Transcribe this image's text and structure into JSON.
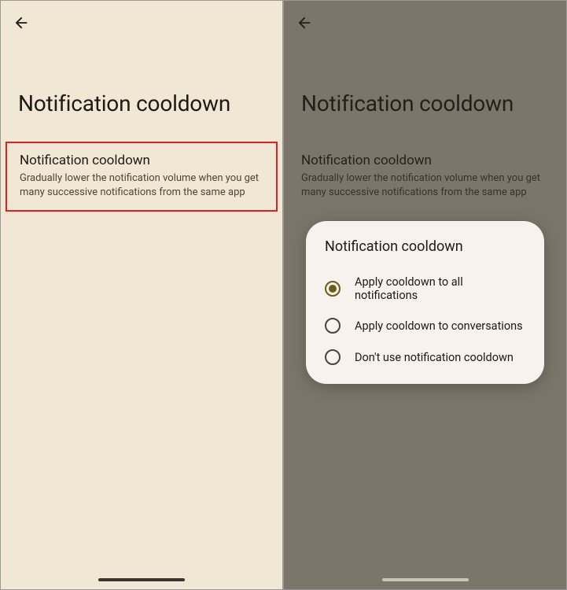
{
  "left": {
    "pageTitle": "Notification cooldown",
    "setting": {
      "title": "Notification cooldown",
      "desc": "Gradually lower the notification volume when you get many successive notifications from the same app"
    }
  },
  "right": {
    "pageTitle": "Notification cooldown",
    "setting": {
      "title": "Notification cooldown",
      "desc": "Gradually lower the notification volume when you get many successive notifications from the same app"
    },
    "dialog": {
      "title": "Notification cooldown",
      "options": {
        "opt0": "Apply cooldown to all notifications",
        "opt1": "Apply cooldown to conversations",
        "opt2": "Don't use notification cooldown"
      }
    }
  }
}
